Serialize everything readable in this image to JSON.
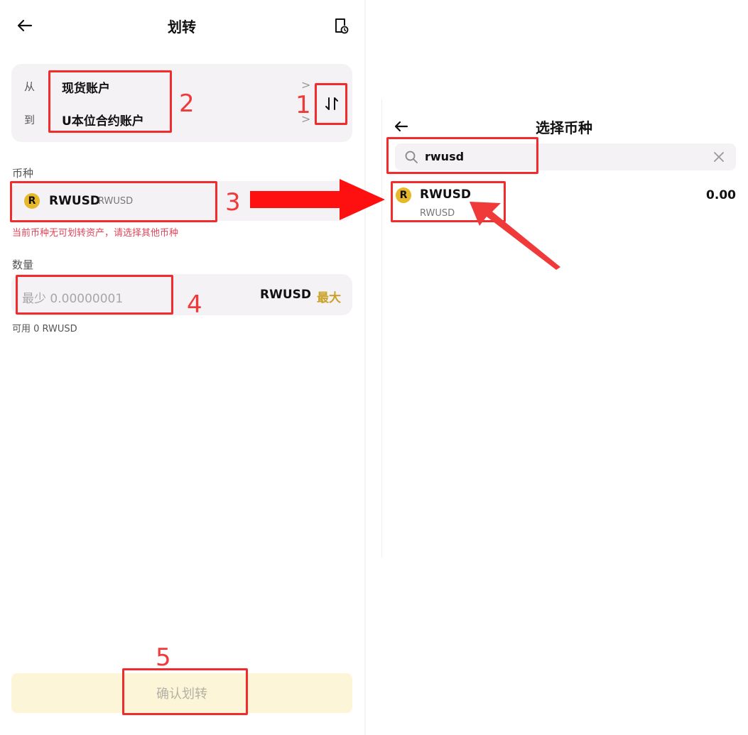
{
  "left": {
    "header": {
      "title": "划转"
    },
    "transfer": {
      "from_label": "从",
      "from_value": "现货账户",
      "to_label": "到",
      "to_value": "U本位合约账户"
    },
    "coin": {
      "section_label": "币种",
      "symbol": "RWUSD",
      "name": "RWUSD",
      "warning": "当前币种无可划转资产，请选择其他币种"
    },
    "amount": {
      "section_label": "数量",
      "placeholder": "最少 0.00000001",
      "unit": "RWUSD",
      "max_label": "最大",
      "available": "可用 0 RWUSD"
    },
    "confirm_label": "确认划转"
  },
  "right": {
    "header": {
      "title": "选择币种"
    },
    "search": {
      "value": "rwusd"
    },
    "results": [
      {
        "symbol": "RWUSD",
        "name": "RWUSD",
        "balance": "0.00"
      }
    ]
  },
  "annotations": [
    "1",
    "2",
    "3",
    "4",
    "5"
  ],
  "colors": {
    "accent_gold": "#c9a227",
    "warning_red": "#e0465a",
    "annotation_red": "#f22c2c",
    "card_bg": "#f5f2f5",
    "confirm_bg": "#fdf5d8"
  },
  "icons": {
    "back": "arrow-left-icon",
    "history": "document-clock-icon",
    "swap": "swap-vertical-icon",
    "search": "search-icon",
    "clear": "close-icon",
    "coin": "rwusd-logo-icon"
  }
}
